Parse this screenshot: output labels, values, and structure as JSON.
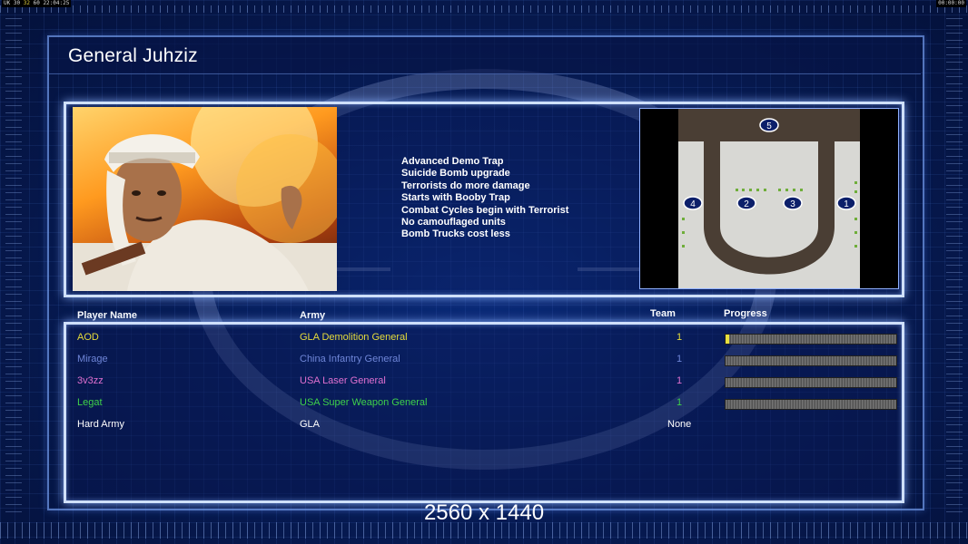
{
  "hud": {
    "left_a": "UK",
    "left_b": "30",
    "left_c": "32",
    "left_d": "60",
    "left_time": "22:04:25",
    "right_time": "00:00:00"
  },
  "general_title": "General Juhziz",
  "bonuses": [
    "Advanced Demo Trap",
    "Suicide Bomb upgrade",
    "Terrorists do more damage",
    "Starts with Booby Trap",
    "Combat Cycles begin with Terrorist",
    "No camouflaged units",
    "Bomb Trucks cost less"
  ],
  "map": {
    "start_positions": [
      "5",
      "4",
      "2",
      "3",
      "1"
    ]
  },
  "table": {
    "headers": {
      "name": "Player Name",
      "army": "Army",
      "team": "Team",
      "progress": "Progress"
    },
    "rows": [
      {
        "name": "AOD",
        "army": "GLA Demolition General",
        "team": "1",
        "color": "#e6dc3a",
        "progress": 0.02
      },
      {
        "name": "Mirage",
        "army": "China Infantry General",
        "team": "1",
        "color": "#6f86d8",
        "progress": 0
      },
      {
        "name": "3v3zz",
        "army": "USA Laser General",
        "team": "1",
        "color": "#e070d0",
        "progress": 0
      },
      {
        "name": "Legat",
        "army": "USA Super Weapon General",
        "team": "1",
        "color": "#3fd24a",
        "progress": 0
      },
      {
        "name": "Hard Army",
        "army": "GLA",
        "team": "None",
        "color": "#ffffff"
      }
    ]
  },
  "resolution_text": "2560 x 1440",
  "colors": {
    "panel_border": "#cfe0ff",
    "background": "#071c57"
  }
}
